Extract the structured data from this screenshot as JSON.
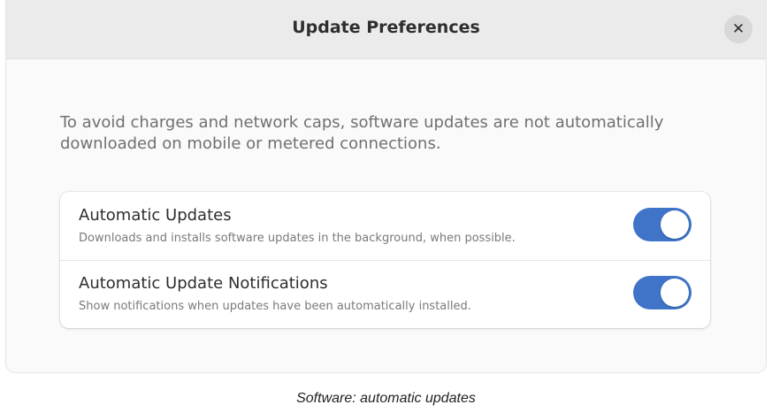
{
  "dialog": {
    "title": "Update Preferences",
    "close_icon": "close-icon",
    "close_glyph": "✕",
    "description": "To avoid charges and network caps, software updates are not automatically downloaded on mobile or metered connections."
  },
  "preferences": [
    {
      "title": "Automatic Updates",
      "subtitle": "Downloads and installs software updates in the background, when possible.",
      "enabled": true
    },
    {
      "title": "Automatic Update Notifications",
      "subtitle": "Show notifications when updates have been automatically installed.",
      "enabled": true
    }
  ],
  "caption": "Software: automatic updates",
  "colors": {
    "accent": "#3f74c9",
    "headerbar": "#ebebeb",
    "window_bg": "#fafafa"
  }
}
